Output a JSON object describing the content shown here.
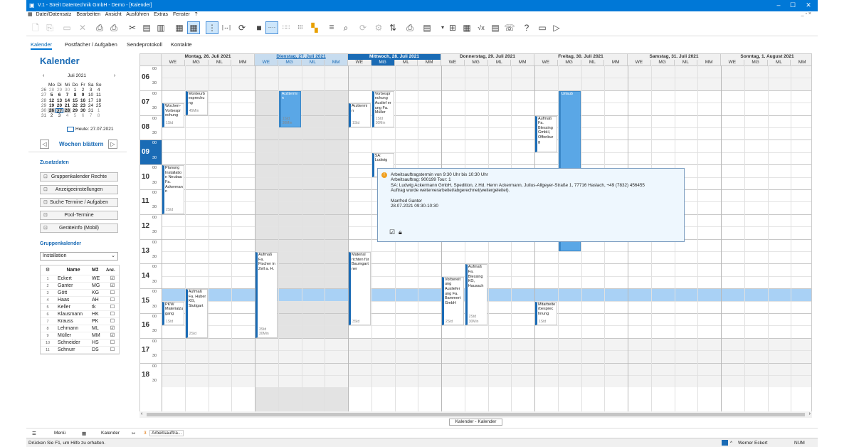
{
  "window": {
    "title": "V.1 - Streit Datentechnik GmbH - Demo - [Kalender]"
  },
  "menu": [
    "Datei/Datensatz",
    "Bearbeiten",
    "Ansicht",
    "Ausführen",
    "Extras",
    "Fenster",
    "?"
  ],
  "tabs": [
    {
      "label": "Kalender",
      "active": true
    },
    {
      "label": "Postfächer / Aufgaben",
      "active": false
    },
    {
      "label": "Sendeprotokoll",
      "active": false
    },
    {
      "label": "Kontakte",
      "active": false
    }
  ],
  "left": {
    "title": "Kalender",
    "mini_calendar": {
      "month_label": "Juli 2021",
      "weekdays": [
        "Mo",
        "Di",
        "Mi",
        "Do",
        "Fr",
        "Sa",
        "So"
      ],
      "weeks": [
        {
          "kw": "26",
          "days": [
            "28",
            "29",
            "30",
            "1",
            "2",
            "3",
            "4"
          ]
        },
        {
          "kw": "27",
          "days": [
            "5",
            "6",
            "7",
            "8",
            "9",
            "10",
            "11"
          ]
        },
        {
          "kw": "28",
          "days": [
            "12",
            "13",
            "14",
            "15",
            "16",
            "17",
            "18"
          ]
        },
        {
          "kw": "29",
          "days": [
            "19",
            "20",
            "21",
            "22",
            "23",
            "24",
            "25"
          ]
        },
        {
          "kw": "30",
          "days": [
            "26",
            "27",
            "28",
            "29",
            "30",
            "31",
            "1"
          ]
        },
        {
          "kw": "31",
          "days": [
            "2",
            "3",
            "4",
            "5",
            "6",
            "7",
            "8"
          ]
        }
      ],
      "today_label": "Heute: 27.07.2021"
    },
    "week_nav_label": "Wochen blättern",
    "zusatzdaten_title": "Zusatzdaten",
    "buttons": [
      "Gruppenkalender Rechte",
      "Anzeigeeinstellungen",
      "Suche Termine / Aufgaben",
      "Pool-Termine",
      "Geräteinfo (Mobil)"
    ],
    "gruppenkalender_title": "Gruppenkalender",
    "group_select": "Installation",
    "table_headers": [
      "Name",
      "Mž",
      "Anz."
    ],
    "people": [
      {
        "n": "1",
        "name": "Eckert",
        "code": "WE",
        "checked": true
      },
      {
        "n": "2",
        "name": "Ganter",
        "code": "MG",
        "checked": true
      },
      {
        "n": "3",
        "name": "Gött",
        "code": "KG",
        "checked": false
      },
      {
        "n": "4",
        "name": "Haas",
        "code": "AH",
        "checked": false
      },
      {
        "n": "5",
        "name": "Keller",
        "code": "tk",
        "checked": false
      },
      {
        "n": "6",
        "name": "Klausmann",
        "code": "HK",
        "checked": false
      },
      {
        "n": "7",
        "name": "Krauss",
        "code": "PK",
        "checked": false
      },
      {
        "n": "8",
        "name": "Lehmann",
        "code": "ML",
        "checked": true
      },
      {
        "n": "9",
        "name": "Müller",
        "code": "MM",
        "checked": true
      },
      {
        "n": "10",
        "name": "Schneider",
        "code": "HS",
        "checked": false
      },
      {
        "n": "11",
        "name": "Schnurr",
        "code": "DS",
        "checked": false
      }
    ]
  },
  "calendar": {
    "days": [
      {
        "label": "Montag, 26. Juli 2021",
        "style": "normal"
      },
      {
        "label": "Dienstag, 27. Juli 2021",
        "style": "today"
      },
      {
        "label": "Mittwoch, 28. Juli 2021",
        "style": "selected"
      },
      {
        "label": "Donnerstag, 29. Juli 2021",
        "style": "normal"
      },
      {
        "label": "Freitag, 30. Juli 2021",
        "style": "normal"
      },
      {
        "label": "Samstag, 31. Juli 2021",
        "style": "normal"
      },
      {
        "label": "Sonntag, 1. August 2021",
        "style": "normal"
      }
    ],
    "subcols": [
      "WE",
      "MG",
      "ML",
      "MM"
    ],
    "hours": [
      "06",
      "07",
      "08",
      "09",
      "10",
      "11",
      "12",
      "13",
      "14",
      "15",
      "16",
      "17",
      "18"
    ],
    "minute_labels": [
      "00",
      "30"
    ],
    "appointments": [
      {
        "text": "Monteurb esprechu ng",
        "foot": "45Min",
        "day": 0,
        "col": 1,
        "start": "07:00",
        "end": "08:00",
        "blue": false
      },
      {
        "text": "Wochen- Vorbespr echung",
        "foot": "1Std",
        "day": 0,
        "col": 0,
        "start": "07:30",
        "end": "08:30",
        "blue": false
      },
      {
        "text": "Planung Installatio n Neubau Fa. Ackerman n",
        "foot": "2Std",
        "day": 0,
        "col": 0,
        "start": "10:00",
        "end": "12:00",
        "blue": false
      },
      {
        "text": "Aufmaß Fa. Huber KG, Stuttgart",
        "foot": "2Std",
        "day": 0,
        "col": 1,
        "start": "15:00",
        "end": "17:00",
        "blue": false
      },
      {
        "text": "PKW Materialzu gang",
        "foot": "1Std",
        "day": 0,
        "col": 0,
        "start": "15:30",
        "end": "16:30",
        "blue": false
      },
      {
        "text": "Arzttermi n",
        "foot": "1Std 30Min",
        "day": 1,
        "col": 1,
        "start": "07:00",
        "end": "08:30",
        "blue": true
      },
      {
        "text": "Aufmaß Fa. Fischer in Zell a. H.",
        "foot": "3Std 30Min",
        "day": 1,
        "col": 0,
        "start": "13:30",
        "end": "17:00",
        "blue": false
      },
      {
        "text": "Arzttermi n",
        "foot": "1Std",
        "day": 2,
        "col": 0,
        "start": "07:30",
        "end": "08:30",
        "blue": false
      },
      {
        "text": "Vorbespr echung Auslief er ung Fa. Müller",
        "foot": "1Std 30Min",
        "day": 2,
        "col": 1,
        "start": "07:00",
        "end": "08:30",
        "blue": false
      },
      {
        "text": "SA: Ludwig",
        "foot": "",
        "day": 2,
        "col": 1,
        "start": "09:30",
        "end": "10:30",
        "blue": false
      },
      {
        "text": "Material richten für Baumgart ner",
        "foot": "3Std",
        "day": 2,
        "col": 0,
        "start": "13:30",
        "end": "16:30",
        "blue": false
      },
      {
        "text": "Vorbereit ung Ausliefer ung Fa. Bammert GmbH",
        "foot": "2Std",
        "day": 3,
        "col": 0,
        "start": "14:30",
        "end": "16:30",
        "blue": false
      },
      {
        "text": "Aufmaß Fa. Blessing KG, Hausach",
        "foot": "2Std 30Min",
        "day": 3,
        "col": 1,
        "start": "14:00",
        "end": "16:30",
        "blue": false
      },
      {
        "text": "Aufmaß Fa. Blessing GmbH, Offenbur g",
        "foot": "",
        "day": 4,
        "col": 0,
        "start": "08:00",
        "end": "09:30",
        "blue": false
      },
      {
        "text": "Urlaub",
        "foot": "",
        "day": 4,
        "col": 1,
        "start": "07:00",
        "end": "13:30",
        "blue": true
      },
      {
        "text": "Mitarbeite rbesprec hnung",
        "foot": "1Std",
        "day": 4,
        "col": 0,
        "start": "15:30",
        "end": "16:30",
        "blue": false
      }
    ]
  },
  "tooltip": {
    "lines": [
      "Arbeitsauftragstermin von 9:30 Uhr bis 10:30 Uhr",
      "Arbeitsauftrag: 900199  Tour: 1",
      "SA: Ludwig Ackermann GmbH, Spedition, z.Hd. Herrn Ackermann, Julius-Allgeyer-Straße 1, 77716 Haslach, +49 (7832) 456455",
      "Auftrag wurde weiterverarbeitet/abgerechnet(weitergeleitet).",
      "",
      "Manfred Ganter",
      "28.07.2021 09:30-10:30"
    ]
  },
  "calendar_path": "Kalender - Kalender",
  "bottom_tabs": [
    {
      "label": "Menü"
    },
    {
      "label": "Kalender"
    },
    {
      "label": "Arbeitsauftra...",
      "count": "3"
    }
  ],
  "status": {
    "help": "Drücken Sie F1, um Hilfe zu erhalten.",
    "user": "Werner Eckert",
    "num": "NUM"
  },
  "colors": {
    "accent": "#0078d7",
    "appointment_blue": "#5aa7e6",
    "highlight_row": "#a9d1f5",
    "today_header": "#c7dcef",
    "selected_header": "#1a6bb5"
  }
}
